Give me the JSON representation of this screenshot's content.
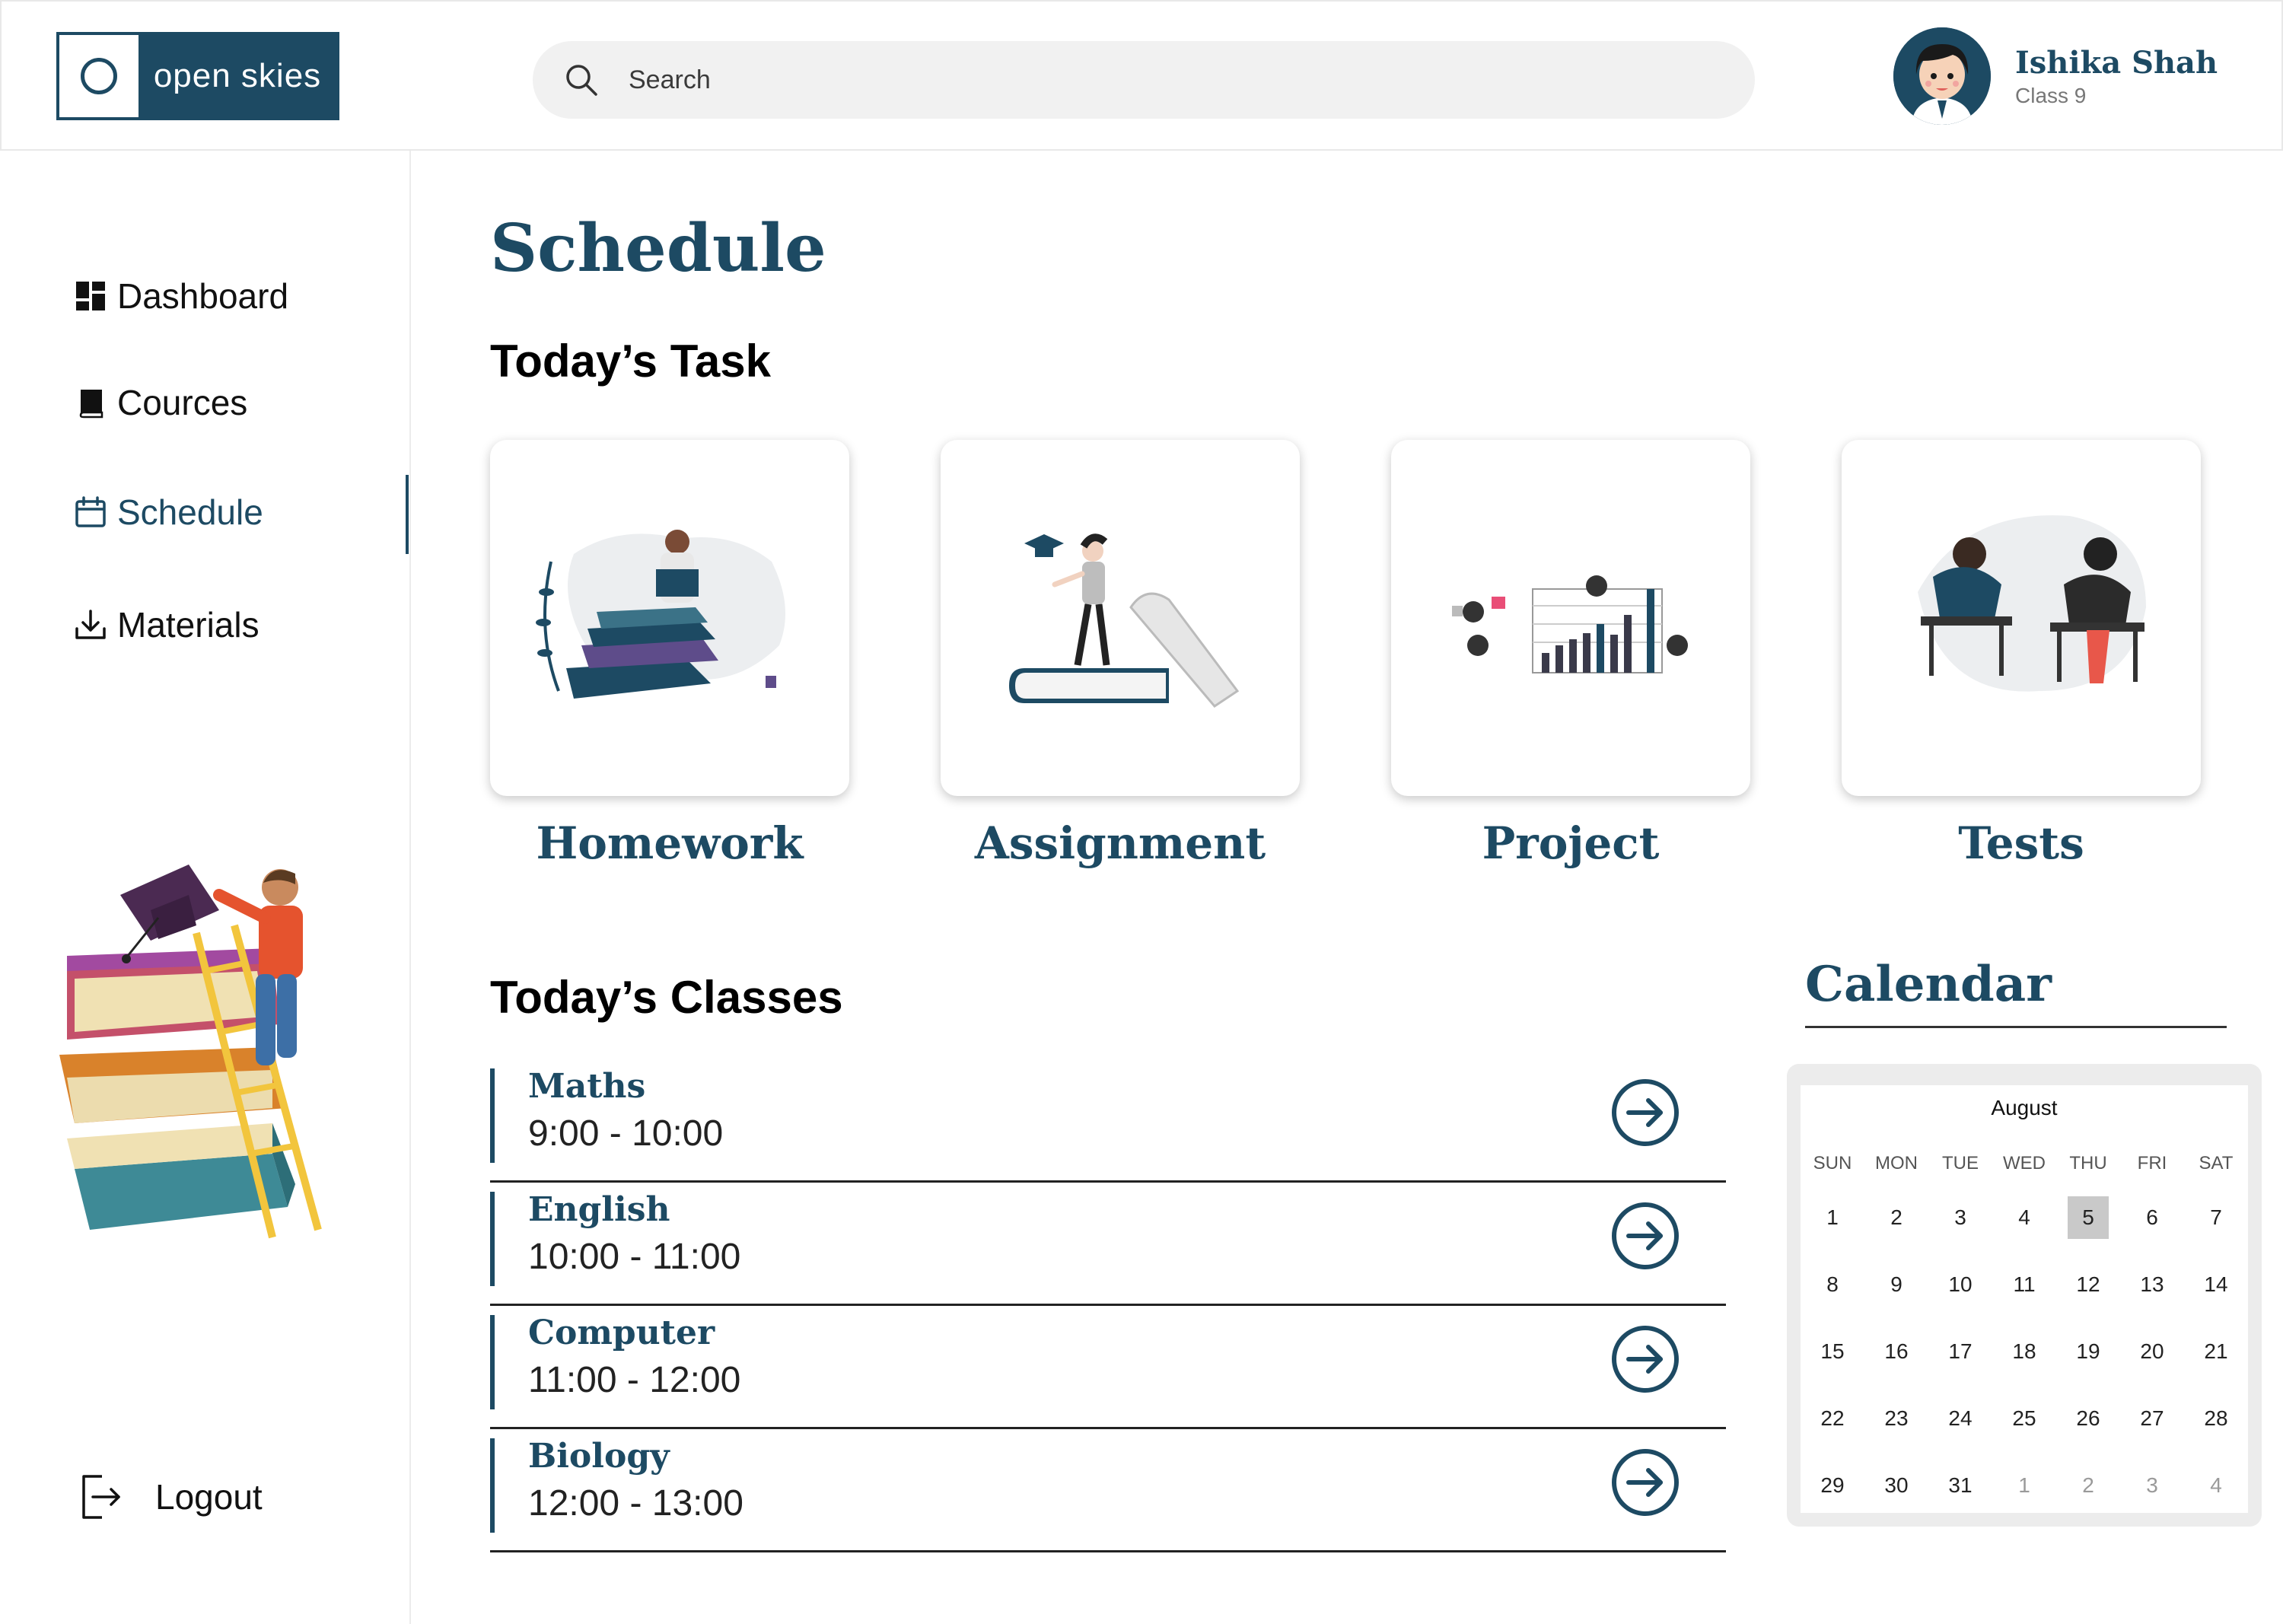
{
  "brand": {
    "name": "open skies"
  },
  "search": {
    "placeholder": "Search"
  },
  "user": {
    "name": "Ishika Shah",
    "class": "Class 9"
  },
  "sidebar": {
    "items": [
      {
        "label": "Dashboard",
        "icon": "dashboard-icon",
        "active": false
      },
      {
        "label": "Cources",
        "icon": "book-icon",
        "active": false
      },
      {
        "label": "Schedule",
        "icon": "calendar-icon",
        "active": true
      },
      {
        "label": "Materials",
        "icon": "download-icon",
        "active": false
      }
    ],
    "logout": {
      "label": "Logout",
      "icon": "logout-icon"
    }
  },
  "main": {
    "title": "Schedule",
    "tasks_heading": "Today’s Task",
    "tasks": [
      {
        "label": "Homework"
      },
      {
        "label": "Assignment"
      },
      {
        "label": "Project"
      },
      {
        "label": "Tests"
      }
    ],
    "classes_heading": "Today’s Classes",
    "classes": [
      {
        "subject": "Maths",
        "time": "9:00 - 10:00"
      },
      {
        "subject": "English",
        "time": "10:00 - 11:00"
      },
      {
        "subject": "Computer",
        "time": "11:00 - 12:00"
      },
      {
        "subject": "Biology",
        "time": "12:00 - 13:00"
      }
    ]
  },
  "calendar": {
    "title": "Calendar",
    "month": "August",
    "weekdays": [
      "SUN",
      "MON",
      "TUE",
      "WED",
      "THU",
      "FRI",
      "SAT"
    ],
    "weeks": [
      [
        "1",
        "2",
        "3",
        "4",
        "5",
        "6",
        "7"
      ],
      [
        "8",
        "9",
        "10",
        "11",
        "12",
        "13",
        "14"
      ],
      [
        "15",
        "16",
        "17",
        "18",
        "19",
        "20",
        "21"
      ],
      [
        "22",
        "23",
        "24",
        "25",
        "26",
        "27",
        "28"
      ],
      [
        "29",
        "30",
        "31",
        "1",
        "2",
        "3",
        "4"
      ]
    ],
    "selected": "5",
    "colors": {
      "accent": "#1d4a63",
      "selected_bg": "#c9c9c9"
    }
  }
}
